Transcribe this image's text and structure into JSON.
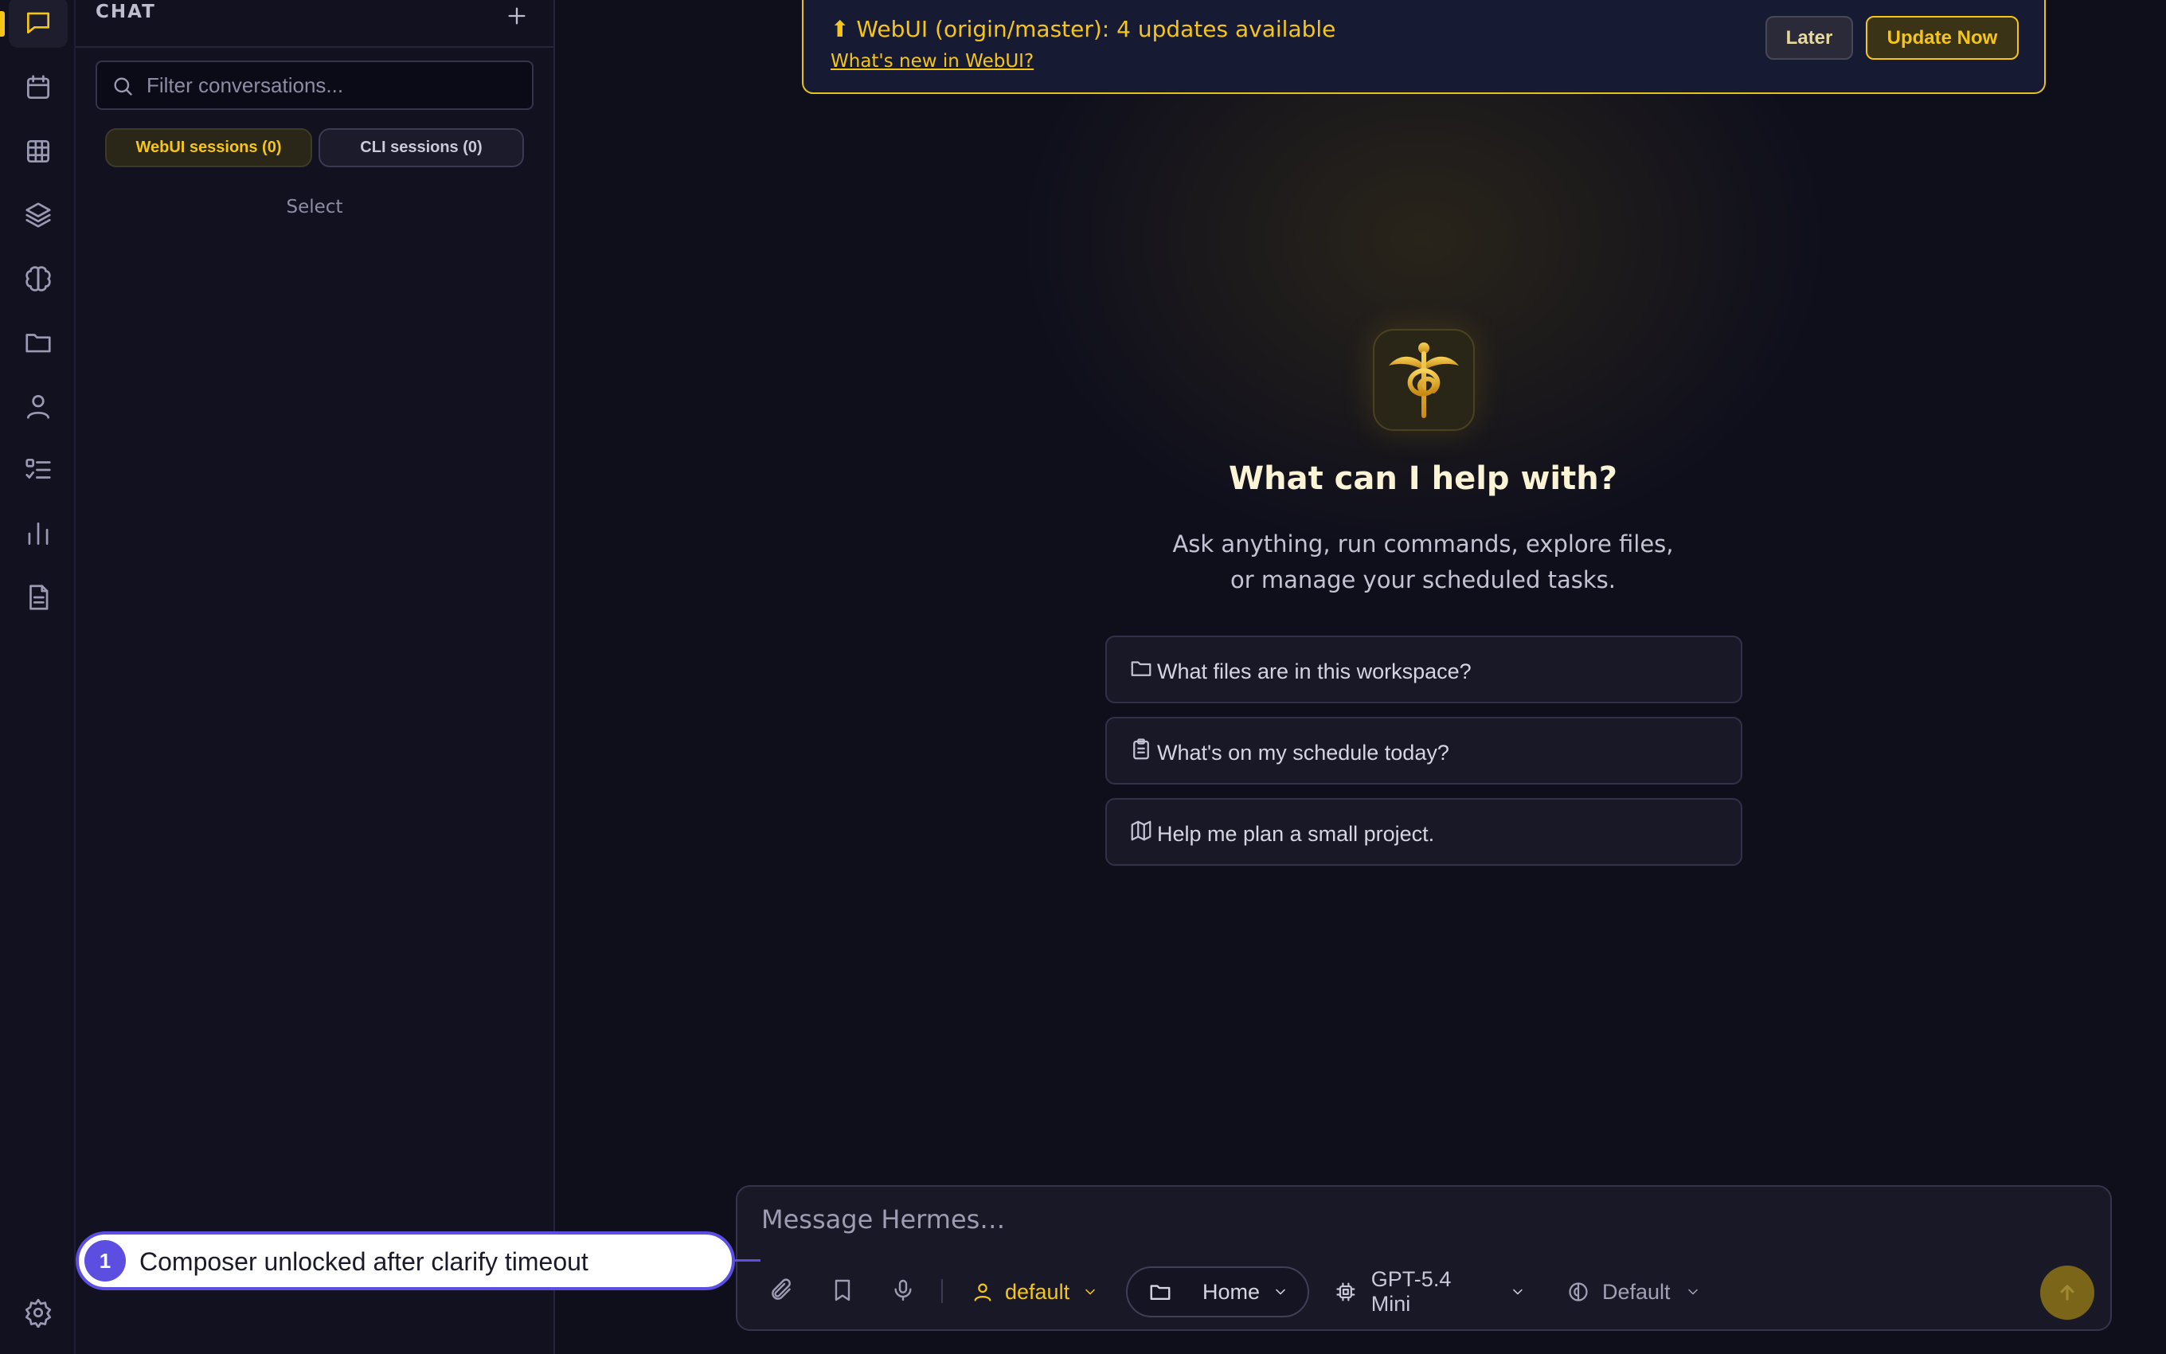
{
  "sidebar": {
    "title": "CHAT",
    "search_placeholder": "Filter conversations...",
    "tabs": [
      {
        "label": "WebUI sessions (0)",
        "active": true
      },
      {
        "label": "CLI sessions (0)",
        "active": false
      }
    ],
    "empty_text": "Select"
  },
  "rail": {
    "items": [
      "chat-icon",
      "calendar-icon",
      "grid-icon",
      "layers-icon",
      "brain-icon",
      "folder-icon",
      "user-icon",
      "checklist-icon",
      "bar-chart-icon",
      "document-icon"
    ],
    "bottom": "settings-icon"
  },
  "banner": {
    "title": "⬆ WebUI (origin/master): 4 updates available",
    "link": "What's new in WebUI?",
    "later_label": "Later",
    "update_label": "Update Now"
  },
  "hero": {
    "title": "What can I help with?",
    "subtitle_line1": "Ask anything, run commands, explore files,",
    "subtitle_line2": "or manage your scheduled tasks."
  },
  "suggestions": [
    {
      "icon": "folder-icon",
      "label": "What files are in this workspace?"
    },
    {
      "icon": "clipboard-icon",
      "label": "What's on my schedule today?"
    },
    {
      "icon": "map-icon",
      "label": "Help me plan a small project."
    }
  ],
  "composer": {
    "placeholder": "Message Hermes…",
    "profile": "default",
    "workspace": "Home",
    "model": "GPT-5.4 Mini",
    "reasoning": "Default"
  },
  "annotation": {
    "number": "1",
    "text": "Composer unlocked after clarify timeout"
  },
  "colors": {
    "accent": "#f5c518",
    "annotation": "#5b4ee0",
    "background": "#0f0f1c"
  }
}
